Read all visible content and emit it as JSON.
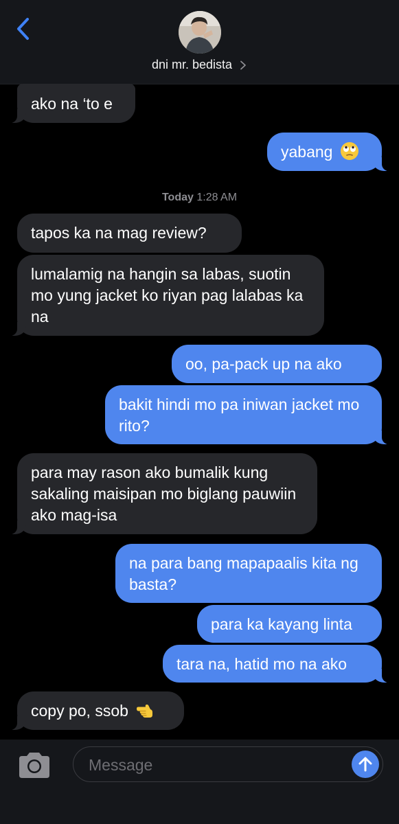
{
  "header": {
    "contact_name": "dni mr. bedista"
  },
  "timestamp": {
    "day": "Today",
    "time": "1:28 AM"
  },
  "messages": [
    {
      "sender": "them",
      "text": "ako na ‘to e"
    },
    {
      "sender": "me",
      "text": "yabang",
      "emoji": "face-with-rolling-eyes-emoji"
    },
    {
      "sender": "them",
      "text": "tapos ka na mag review?"
    },
    {
      "sender": "them",
      "text": "lumalamig na hangin sa labas, suotin mo yung jacket ko riyan pag lalabas ka na"
    },
    {
      "sender": "me",
      "text": "oo, pa-pack up na ako"
    },
    {
      "sender": "me",
      "text": "bakit hindi mo pa iniwan jacket mo rito?"
    },
    {
      "sender": "them",
      "text": "para may rason ako bumalik kung sakaling maisipan mo biglang pauwiin ako mag-isa"
    },
    {
      "sender": "me",
      "text": "na para bang mapapaalis kita ng basta?"
    },
    {
      "sender": "me",
      "text": "para ka kayang linta"
    },
    {
      "sender": "me",
      "text": "tara na, hatid mo na ako"
    },
    {
      "sender": "them",
      "text": "copy po, ssob",
      "emoji": "backhand-index-pointing-left-emoji"
    }
  ],
  "composer": {
    "placeholder": "Message"
  },
  "colors": {
    "outgoing_bubble": "#4f86ee",
    "incoming_bubble": "#26272b",
    "background": "#000000",
    "accent": "#3f82f6"
  }
}
